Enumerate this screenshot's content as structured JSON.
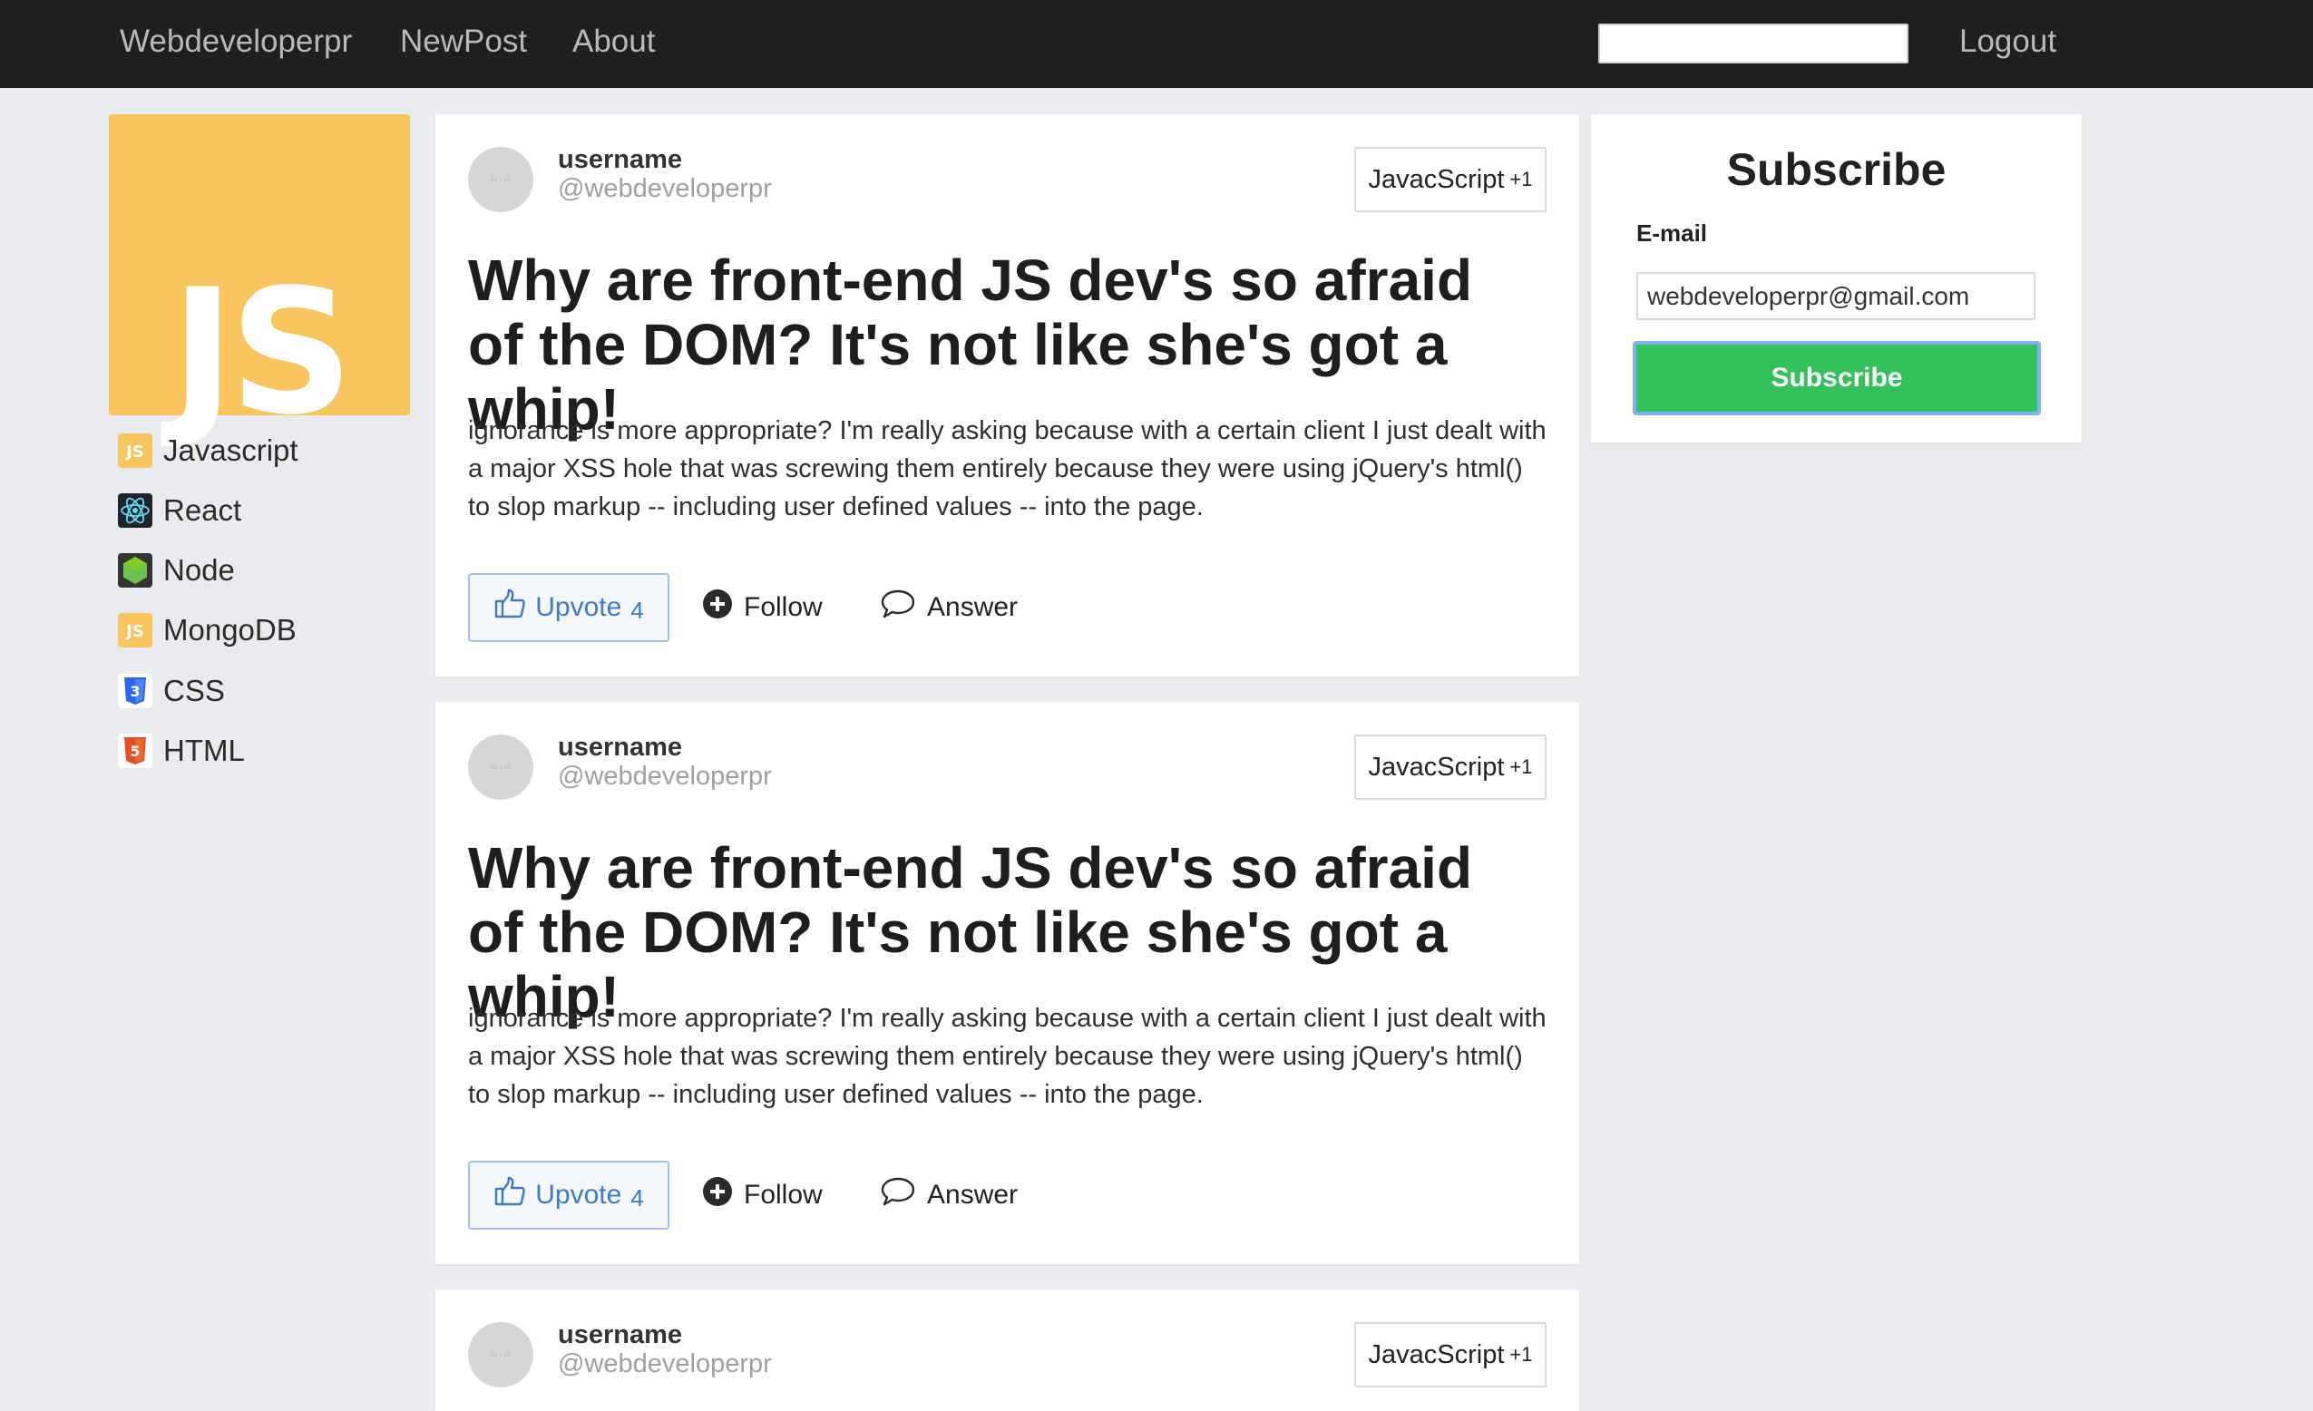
{
  "nav": {
    "brand": "Webdeveloperpr",
    "links": [
      "NewPost",
      "About"
    ],
    "search_value": "",
    "logout": "Logout"
  },
  "logo": {
    "text": "JS",
    "color": "#f9c55e"
  },
  "sidebar": {
    "items": [
      {
        "label": "Javascript",
        "icon": "javascript-icon"
      },
      {
        "label": "React",
        "icon": "react-icon"
      },
      {
        "label": "Node",
        "icon": "node-icon"
      },
      {
        "label": "MongoDB",
        "icon": "mongodb-icon"
      },
      {
        "label": "CSS",
        "icon": "css3-icon"
      },
      {
        "label": "HTML",
        "icon": "html5-icon"
      }
    ]
  },
  "avatar_placeholder": "60 x 60",
  "posts": [
    {
      "username": "username",
      "handle": "@webdeveloperpr",
      "tag": "JavacScript",
      "tag_count": "+1",
      "title": "Why are front-end JS dev's so afraid of the DOM? It's not like she's got a whip!",
      "body": "ignorance is more appropriate? I'm really asking because with a certain client I just dealt with a major XSS hole that was screwing them entirely because they were using jQuery's html() to slop markup -- including user defined values -- into the page.",
      "upvote_label": "Upvote",
      "upvote_count": "4",
      "follow_label": "Follow",
      "answer_label": "Answer"
    },
    {
      "username": "username",
      "handle": "@webdeveloperpr",
      "tag": "JavacScript",
      "tag_count": "+1",
      "title": "Why are front-end JS dev's so afraid of the DOM? It's not like she's got a whip!",
      "body": "ignorance is more appropriate? I'm really asking because with a certain client I just dealt with a major XSS hole that was screwing them entirely because they were using jQuery's html() to slop markup -- including user defined values -- into the page.",
      "upvote_label": "Upvote",
      "upvote_count": "4",
      "follow_label": "Follow",
      "answer_label": "Answer"
    },
    {
      "username": "username",
      "handle": "@webdeveloperpr",
      "tag": "JavacScript",
      "tag_count": "+1"
    }
  ],
  "subscribe": {
    "title": "Subscribe",
    "email_label": "E-mail",
    "email_value": "webdeveloperpr@gmail.com",
    "button_label": "Subscribe"
  },
  "colors": {
    "navbar": "#1f1f1f",
    "subscribe_button": "#32c15a",
    "upvote": "#3b7cc4"
  }
}
